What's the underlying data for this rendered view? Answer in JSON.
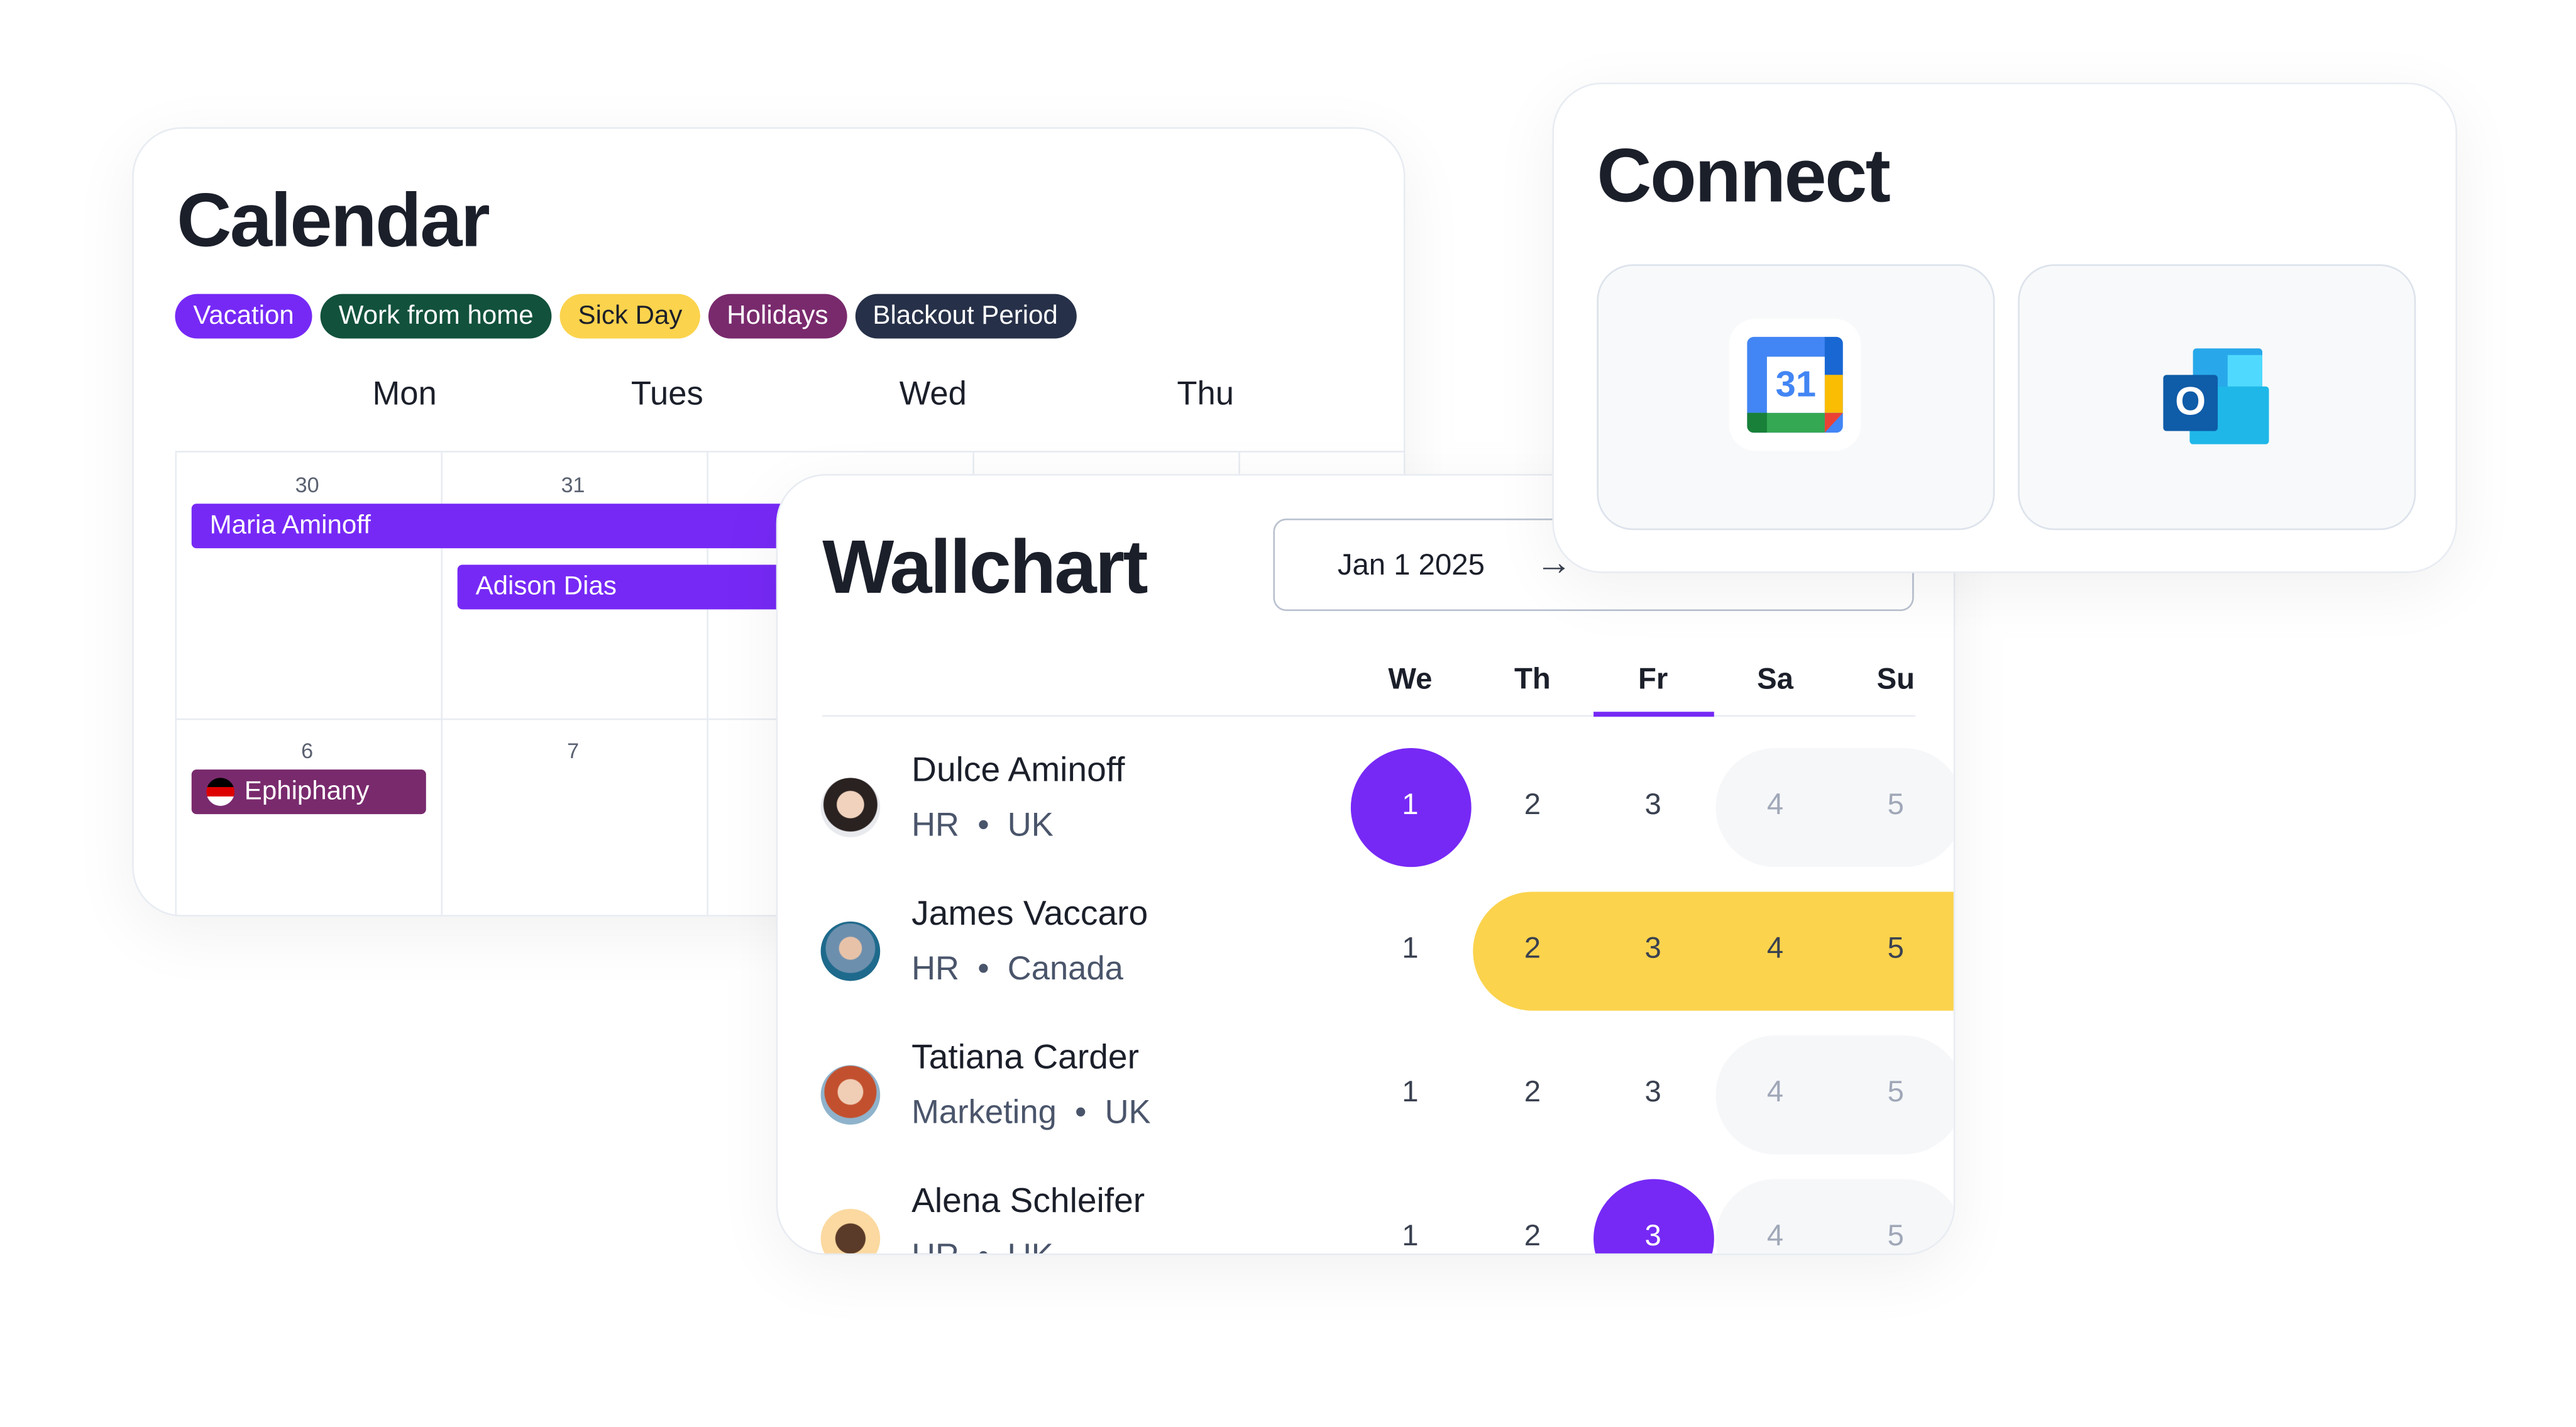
{
  "calendar": {
    "title": "Calendar",
    "legend": [
      {
        "label": "Vacation",
        "color": "#7629f5"
      },
      {
        "label": "Work from home",
        "color": "#12513b"
      },
      {
        "label": "Sick Day",
        "color": "#fbd34d"
      },
      {
        "label": "Holidays",
        "color": "#792a6d"
      },
      {
        "label": "Blackout Period",
        "color": "#263048"
      }
    ],
    "days": [
      "Mon",
      "Tues",
      "Wed",
      "Thu"
    ],
    "dates": [
      "30",
      "31",
      "6",
      "7"
    ],
    "events": [
      {
        "label": "Maria Aminoff"
      },
      {
        "label": "Adison Dias"
      },
      {
        "label": "Ephiphany"
      }
    ]
  },
  "wallchart": {
    "title": "Wallchart",
    "date": "Jan 1 2025",
    "arrow": "→",
    "weekdays": [
      "We",
      "Th",
      "Fr",
      "Sa",
      "Su"
    ],
    "selected_weekday": "Fr",
    "people": [
      {
        "name": "Dulce Aminoff",
        "dept": "HR",
        "country": "UK",
        "days": [
          "1",
          "2",
          "3",
          "4",
          "5"
        ],
        "highlight": "1"
      },
      {
        "name": "James Vaccaro",
        "dept": "HR",
        "country": "Canada",
        "days": [
          "1",
          "2",
          "3",
          "4",
          "5"
        ],
        "sick_range": "2-5"
      },
      {
        "name": "Tatiana Carder",
        "dept": "Marketing",
        "country": "UK",
        "days": [
          "1",
          "2",
          "3",
          "4",
          "5"
        ]
      },
      {
        "name": "Alena Schleifer",
        "dept": "HR",
        "country": "UK",
        "days": [
          "1",
          "2",
          "3",
          "4",
          "5"
        ],
        "highlight": "3"
      }
    ]
  },
  "connect": {
    "title": "Connect",
    "providers": [
      {
        "name": "Google Calendar",
        "icon": "google-calendar-icon",
        "label": "31"
      },
      {
        "name": "Outlook",
        "icon": "outlook-icon",
        "label": "O"
      }
    ]
  }
}
